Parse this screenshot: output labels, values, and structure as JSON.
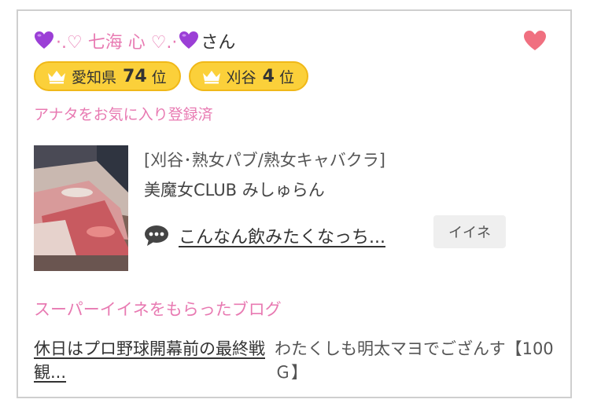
{
  "user": {
    "name_prefix": "·.♡ 七海 心 ♡.·",
    "name_suffix": "さん",
    "heart_color": "#9b3fd6",
    "favorite_heart_color": "#f07080"
  },
  "badges": [
    {
      "icon": "crown-icon",
      "area": "愛知県",
      "rank": "74",
      "unit": "位"
    },
    {
      "icon": "crown-icon",
      "area": "刈谷",
      "rank": "4",
      "unit": "位"
    }
  ],
  "favorite_status": "アナタをお気に入り登録済",
  "shop": {
    "category": "[刈谷･熟女パブ/熟女キャバクラ]",
    "name": "美魔女CLUB みしゅらん"
  },
  "post": {
    "icon": "speech-bubble-icon",
    "title": "こんなん飲みたくなっち...",
    "like_label": "イイネ"
  },
  "blog_section": {
    "title": "スーパーイイネをもらったブログ",
    "entry_title": "休日はプロ野球開幕前の最終戦観...",
    "entry_author": "わたくしも明太マヨでござんす【100Ｇ】"
  },
  "colors": {
    "accent_pink": "#e87ab2",
    "badge_gold": "#fbd03a"
  }
}
